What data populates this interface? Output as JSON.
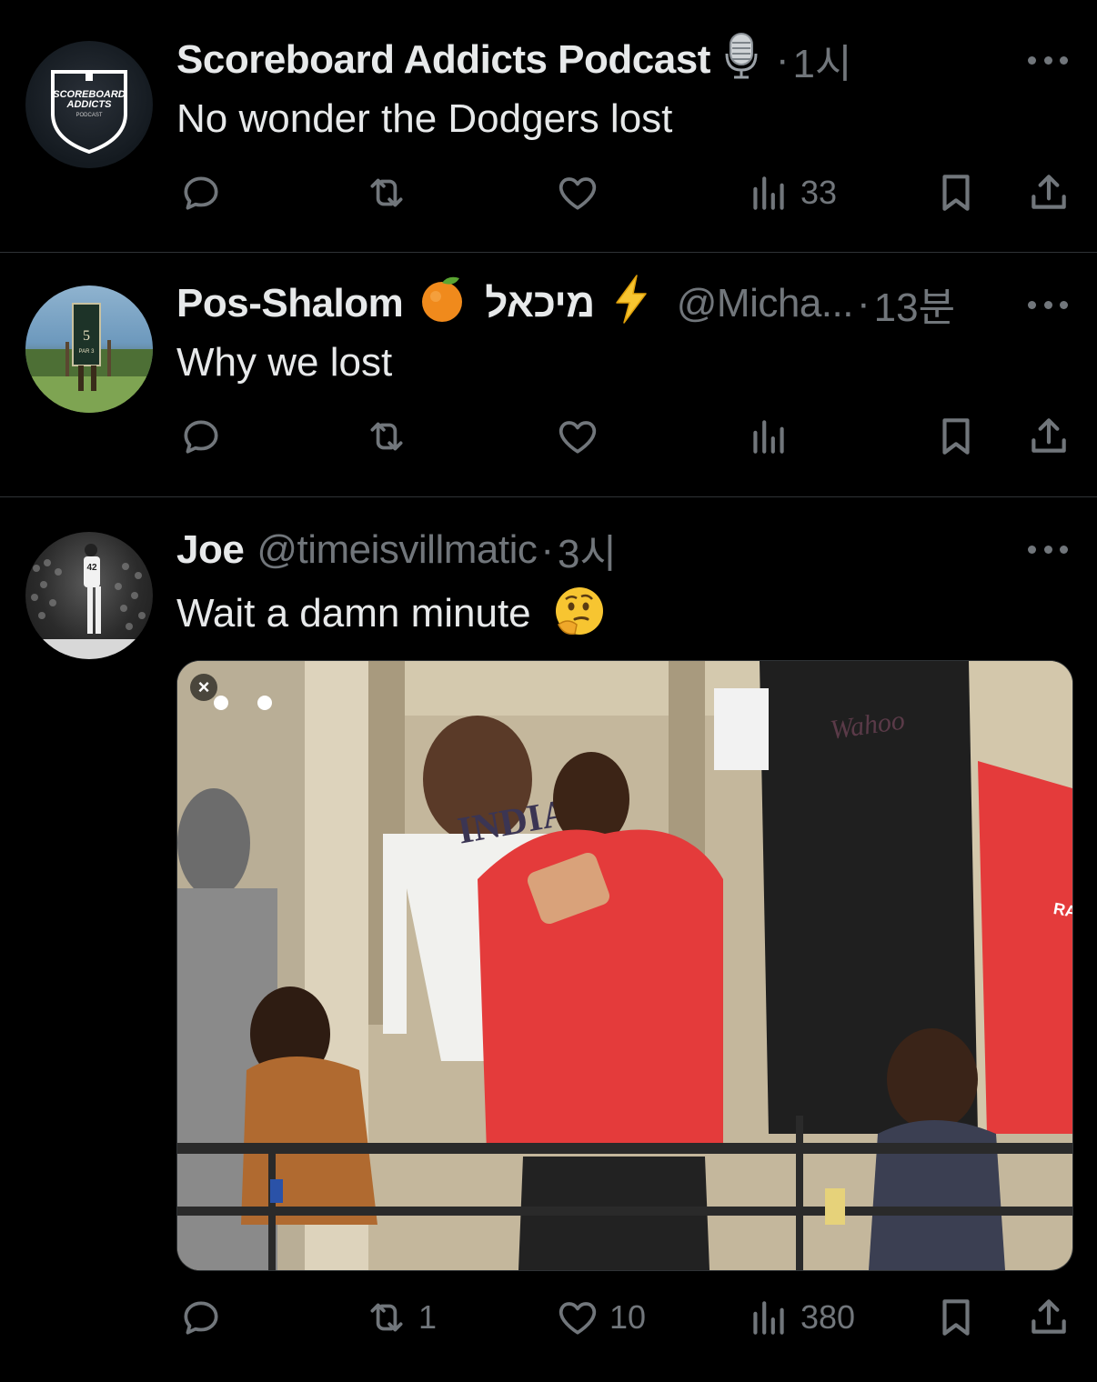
{
  "tweets": [
    {
      "name": "Scoreboard Addicts Podcast",
      "handle": "",
      "dot": "·",
      "time": "1시",
      "text": "No wonder the Dodgers lost",
      "avatar_text": [
        "SCOREBOARD",
        "ADDICTS",
        "PODCAST"
      ],
      "counts": {
        "reply": "",
        "retweet": "",
        "like": "",
        "views": "33"
      }
    },
    {
      "name": "Pos-Shalom",
      "name_hebrew": "מיכאל",
      "handle": "@Micha...",
      "dot": "·",
      "time": "13분",
      "text": "Why we lost",
      "avatar_text": [
        "5",
        "PAR 3"
      ],
      "counts": {
        "reply": "",
        "retweet": "",
        "like": "",
        "views": ""
      }
    },
    {
      "name": "Joe",
      "handle": "@timeisvillmatic",
      "dot": "·",
      "time": "3시",
      "text": "Wait a damn minute",
      "avatar_text": [
        "42"
      ],
      "media_text": [
        "INDIA",
        "Wahoo",
        "RA"
      ],
      "counts": {
        "reply": "",
        "retweet": "1",
        "like": "10",
        "views": "380"
      }
    }
  ],
  "media_close": "×",
  "colors": {
    "background": "#000000",
    "text": "#e7e9ea",
    "muted": "#71767b",
    "divider": "#2f3336"
  }
}
